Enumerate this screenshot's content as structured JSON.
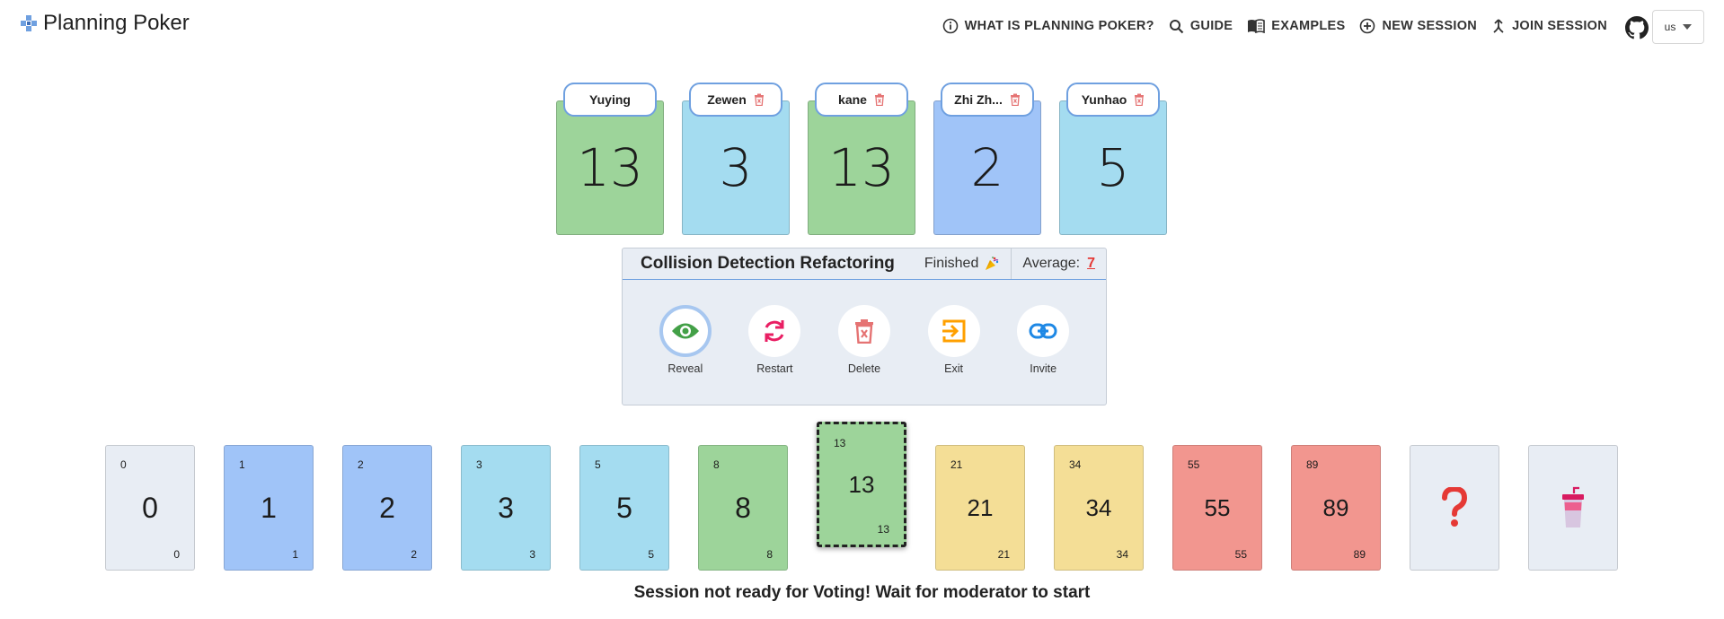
{
  "app": {
    "title": "Planning Poker"
  },
  "nav": [
    {
      "label": "WHAT IS PLANNING POKER?",
      "icon": "info-icon"
    },
    {
      "label": "GUIDE",
      "icon": "search-icon"
    },
    {
      "label": "EXAMPLES",
      "icon": "book-icon"
    },
    {
      "label": "NEW SESSION",
      "icon": "add-circle-icon"
    },
    {
      "label": "JOIN SESSION",
      "icon": "merge-icon"
    }
  ],
  "language": {
    "value": "us"
  },
  "players": [
    {
      "name": "Yuying",
      "vote": "13",
      "color": "#9dd49a",
      "deletable": false
    },
    {
      "name": "Zewen",
      "vote": "3",
      "color": "#a4dcf0",
      "deletable": true
    },
    {
      "name": "kane",
      "vote": "13",
      "color": "#9dd49a",
      "deletable": true
    },
    {
      "name": "Zhi Zh...",
      "vote": "2",
      "color": "#a0c4f8",
      "deletable": true
    },
    {
      "name": "Yunhao",
      "vote": "5",
      "color": "#a4dcf0",
      "deletable": true
    }
  ],
  "story": {
    "title": "Collision Detection Refactoring",
    "status": "Finished",
    "average_label": "Average:",
    "average_value": "7"
  },
  "actions": [
    {
      "label": "Reveal",
      "icon": "eye-icon",
      "color": "#43a047"
    },
    {
      "label": "Restart",
      "icon": "restart-icon",
      "color": "#e91e63"
    },
    {
      "label": "Delete",
      "icon": "delete-icon",
      "color": "#e57373"
    },
    {
      "label": "Exit",
      "icon": "exit-icon",
      "color": "#ffa000"
    },
    {
      "label": "Invite",
      "icon": "link-icon",
      "color": "#1e88e5"
    }
  ],
  "cards": [
    {
      "value": "0",
      "color": "#e8edf4"
    },
    {
      "value": "1",
      "color": "#a0c4f8"
    },
    {
      "value": "2",
      "color": "#a0c4f8"
    },
    {
      "value": "3",
      "color": "#a4dcf0"
    },
    {
      "value": "5",
      "color": "#a4dcf0"
    },
    {
      "value": "8",
      "color": "#9dd49a"
    },
    {
      "value": "13",
      "color": "#9dd49a",
      "selected": true
    },
    {
      "value": "21",
      "color": "#f4de96"
    },
    {
      "value": "34",
      "color": "#f4de96"
    },
    {
      "value": "55",
      "color": "#f2968f"
    },
    {
      "value": "89",
      "color": "#f2968f"
    },
    {
      "value": "?",
      "color": "#e8edf4",
      "icon": "question-icon"
    },
    {
      "value": "coffee",
      "color": "#e8edf4",
      "icon": "coffee-icon"
    }
  ],
  "message": "Session not ready for Voting! Wait for moderator to start"
}
